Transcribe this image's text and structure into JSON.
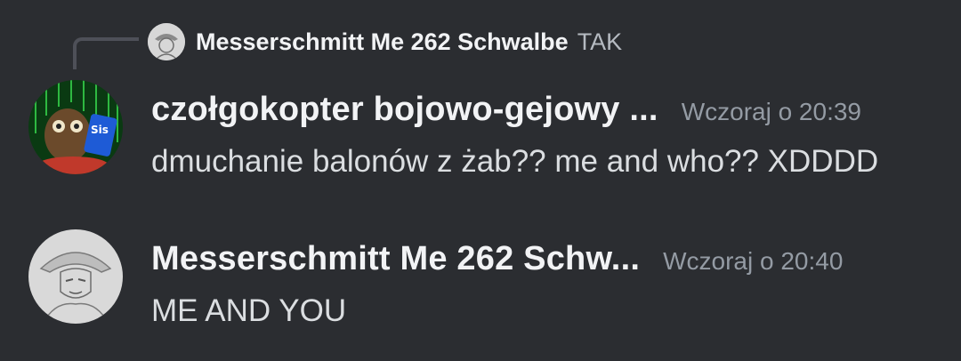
{
  "reply": {
    "author": "Messerschmitt Me 262 Schwalbe",
    "text": "TAK"
  },
  "messages": [
    {
      "author": "czołgokopter bojowo-gejowy ...",
      "timestamp": "Wczoraj o 20:39",
      "content": "dmuchanie balonów z żab?? me and who?? XDDDD"
    },
    {
      "author": "Messerschmitt Me 262 Schw...",
      "timestamp": "Wczoraj o 20:40",
      "content": "ME AND YOU"
    }
  ],
  "colors": {
    "background": "#2b2d31",
    "author": "#f2f3f5",
    "timestamp": "#949ba4",
    "content": "#dbdee1",
    "reply_line": "#4e5058"
  }
}
